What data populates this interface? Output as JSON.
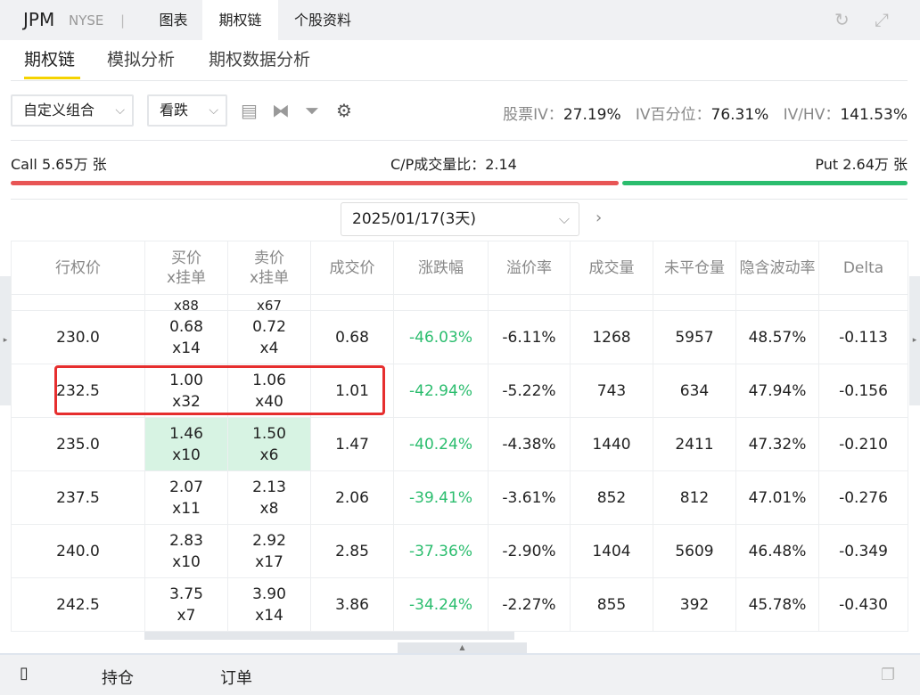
{
  "header": {
    "ticker": "JPM",
    "exchange": "NYSE",
    "separator": "|",
    "tabs": [
      "图表",
      "期权链",
      "个股资料"
    ],
    "active_tab": "期权链"
  },
  "subtabs": [
    "期权链",
    "模拟分析",
    "期权数据分析"
  ],
  "toolbar": {
    "strategy": "自定义组合",
    "direction": "看跌",
    "stock_iv_label": "股票IV：",
    "stock_iv": "27.19%",
    "iv_pct_label": "IV百分位：",
    "iv_pct": "76.31%",
    "iv_hv_label": "IV/HV：",
    "iv_hv": "141.53%"
  },
  "volume": {
    "call": "Call 5.65万 张",
    "cp_ratio": "C/P成交量比：2.14",
    "put": "Put 2.64万 张",
    "call_share": 0.68,
    "colors": {
      "call": "#e85555",
      "put": "#2bbd6e"
    }
  },
  "expiry": "2025/01/17(3天)",
  "table": {
    "headers": [
      "行权价",
      "买价\nx挂单",
      "卖价\nx挂单",
      "成交价",
      "涨跌幅",
      "溢价率",
      "成交量",
      "未平仓量",
      "隐含波动率",
      "Delta"
    ],
    "partial": [
      "",
      "x88",
      "x67",
      "",
      "",
      "",
      "",
      "",
      "",
      ""
    ],
    "rows": [
      {
        "strike": "230.0",
        "bid": "0.68",
        "bid_size": "x14",
        "ask": "0.72",
        "ask_size": "x4",
        "last": "0.68",
        "change": "-46.03%",
        "premium": "-6.11%",
        "volume": "1268",
        "oi": "5957",
        "iv": "48.57%",
        "delta": "-0.113"
      },
      {
        "strike": "232.5",
        "bid": "1.00",
        "bid_size": "x32",
        "ask": "1.06",
        "ask_size": "x40",
        "last": "1.01",
        "change": "-42.94%",
        "premium": "-5.22%",
        "volume": "743",
        "oi": "634",
        "iv": "47.94%",
        "delta": "-0.156"
      },
      {
        "strike": "235.0",
        "bid": "1.46",
        "bid_size": "x10",
        "ask": "1.50",
        "ask_size": "x6",
        "last": "1.47",
        "change": "-40.24%",
        "premium": "-4.38%",
        "volume": "1440",
        "oi": "2411",
        "iv": "47.32%",
        "delta": "-0.210"
      },
      {
        "strike": "237.5",
        "bid": "2.07",
        "bid_size": "x11",
        "ask": "2.13",
        "ask_size": "x8",
        "last": "2.06",
        "change": "-39.41%",
        "premium": "-3.61%",
        "volume": "852",
        "oi": "812",
        "iv": "47.01%",
        "delta": "-0.276"
      },
      {
        "strike": "240.0",
        "bid": "2.83",
        "bid_size": "x10",
        "ask": "2.92",
        "ask_size": "x17",
        "last": "2.85",
        "change": "-37.36%",
        "premium": "-2.90%",
        "volume": "1404",
        "oi": "5609",
        "iv": "46.48%",
        "delta": "-0.349"
      },
      {
        "strike": "242.5",
        "bid": "3.75",
        "bid_size": "x7",
        "ask": "3.90",
        "ask_size": "x14",
        "last": "3.86",
        "change": "-34.24%",
        "premium": "-2.27%",
        "volume": "855",
        "oi": "392",
        "iv": "45.78%",
        "delta": "-0.430"
      }
    ]
  },
  "bottom": {
    "tabs": [
      "持仓",
      "订单"
    ]
  }
}
